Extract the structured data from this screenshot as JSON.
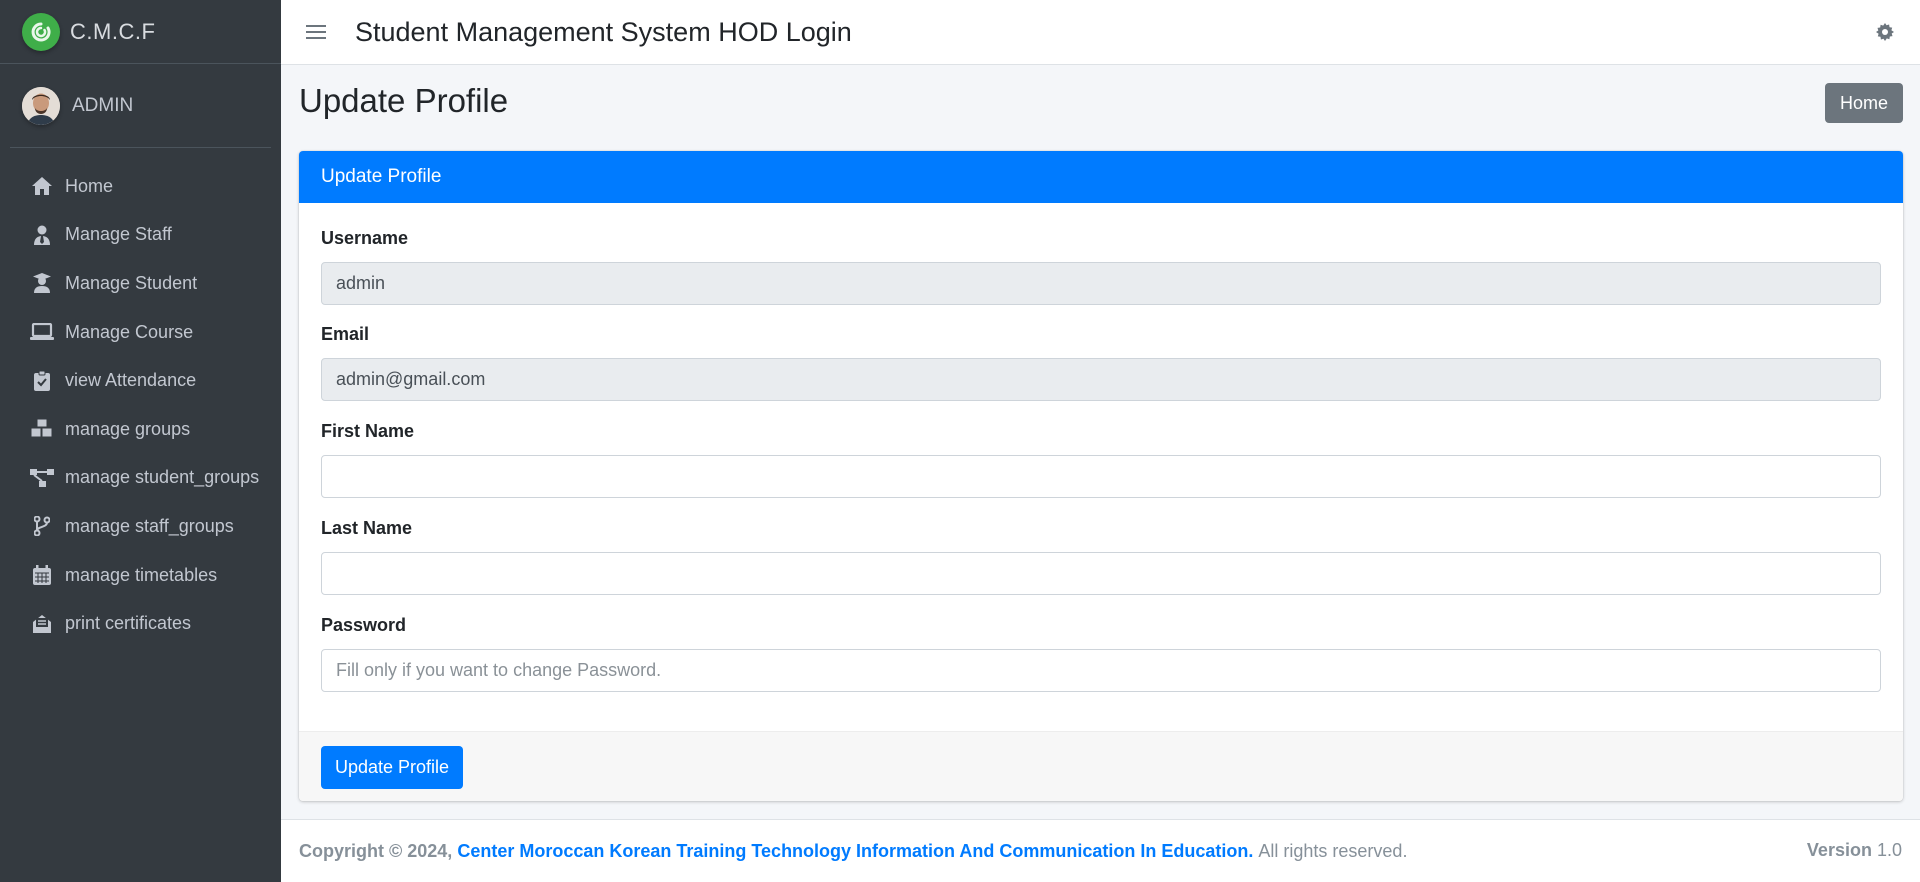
{
  "brand": {
    "name": "C.M.C.F"
  },
  "user": {
    "name": "ADMIN"
  },
  "sidebar": {
    "items": [
      {
        "label": "Home",
        "icon": "home-icon"
      },
      {
        "label": "Manage Staff",
        "icon": "user-tie-icon"
      },
      {
        "label": "Manage Student",
        "icon": "user-graduate-icon"
      },
      {
        "label": "Manage Course",
        "icon": "laptop-icon"
      },
      {
        "label": "view Attendance",
        "icon": "clipboard-check-icon"
      },
      {
        "label": "manage groups",
        "icon": "cubes-icon"
      },
      {
        "label": "manage student_groups",
        "icon": "project-diagram-icon"
      },
      {
        "label": "manage staff_groups",
        "icon": "code-branch-icon"
      },
      {
        "label": "manage timetables",
        "icon": "calendar-icon"
      },
      {
        "label": "print certificates",
        "icon": "envelope-open-text-icon"
      }
    ]
  },
  "header": {
    "title": "Student Management System HOD Login"
  },
  "page": {
    "title": "Update Profile",
    "home_button": "Home"
  },
  "card": {
    "header": "Update Profile",
    "fields": {
      "username": {
        "label": "Username",
        "value": "admin"
      },
      "email": {
        "label": "Email",
        "value": "admin@gmail.com"
      },
      "first_name": {
        "label": "First Name",
        "value": ""
      },
      "last_name": {
        "label": "Last Name",
        "value": ""
      },
      "password": {
        "label": "Password",
        "placeholder": "Fill only if you want to change Password."
      }
    },
    "submit_label": "Update Profile"
  },
  "footer": {
    "copyright": "Copyright © 2024,",
    "org": "Center Moroccan Korean Training Technology Information And Communication In Education.",
    "rights": "All rights reserved.",
    "version_label": "Version",
    "version_value": "1.0"
  },
  "colors": {
    "primary": "#007bff",
    "sidebar": "#343a40",
    "secondary": "#6c757d",
    "brand_logo": "#3fae49"
  }
}
